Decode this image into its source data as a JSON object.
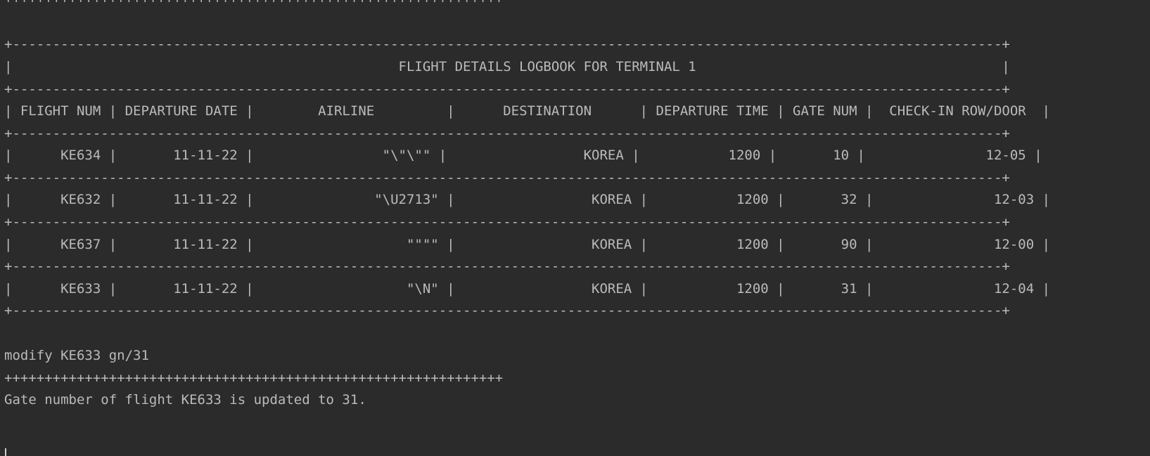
{
  "console": {
    "top_rule": "++++++++++++++++++++++++++++++++++++++++++++++++++++++++++++++",
    "logbook": {
      "border": "+---------------------------------------------------------------------------------------------------------------------------+",
      "title_row": "|                                                FLIGHT DETAILS LOGBOOK FOR TERMINAL 1                                      |",
      "header_row": "| FLIGHT NUM | DEPARTURE DATE |        AIRLINE         |      DESTINATION      | DEPARTURE TIME | GATE NUM |  CHECK-IN ROW/DOOR  |",
      "columns": [
        "FLIGHT NUM",
        "DEPARTURE DATE",
        "AIRLINE",
        "DESTINATION",
        "DEPARTURE TIME",
        "GATE NUM",
        "CHECK-IN ROW/DOOR"
      ],
      "rows": [
        {
          "text": "|      KE634 |       11-11-22 |                \"\\\"\\\"\" |                 KOREA |           1200 |       10 |               12-05 |",
          "cells": [
            "KE634",
            "11-11-22",
            "\"\\\"\\\"\"",
            "KOREA",
            "1200",
            "10",
            "12-05"
          ]
        },
        {
          "text": "|      KE632 |       11-11-22 |               \"\\U2713\" |                 KOREA |           1200 |       32 |               12-03 |",
          "cells": [
            "KE632",
            "11-11-22",
            "\"\\U2713\"",
            "KOREA",
            "1200",
            "32",
            "12-03"
          ]
        },
        {
          "text": "|      KE637 |       11-11-22 |                   \"\"\"\" |                 KOREA |           1200 |       90 |               12-00 |",
          "cells": [
            "KE637",
            "11-11-22",
            "\"\"\"\"",
            "KOREA",
            "1200",
            "90",
            "12-00"
          ]
        },
        {
          "text": "|      KE633 |       11-11-22 |                   \"\\N\" |                 KOREA |           1200 |       31 |               12-04 |",
          "cells": [
            "KE633",
            "11-11-22",
            "\"\\N\"",
            "KOREA",
            "1200",
            "31",
            "12-04"
          ]
        }
      ]
    },
    "command": "modify KE633 gn/31",
    "command_rule": "++++++++++++++++++++++++++++++++++++++++++++++++++++++++++++++",
    "response": "Gate number of flight KE633 is updated to 31."
  }
}
